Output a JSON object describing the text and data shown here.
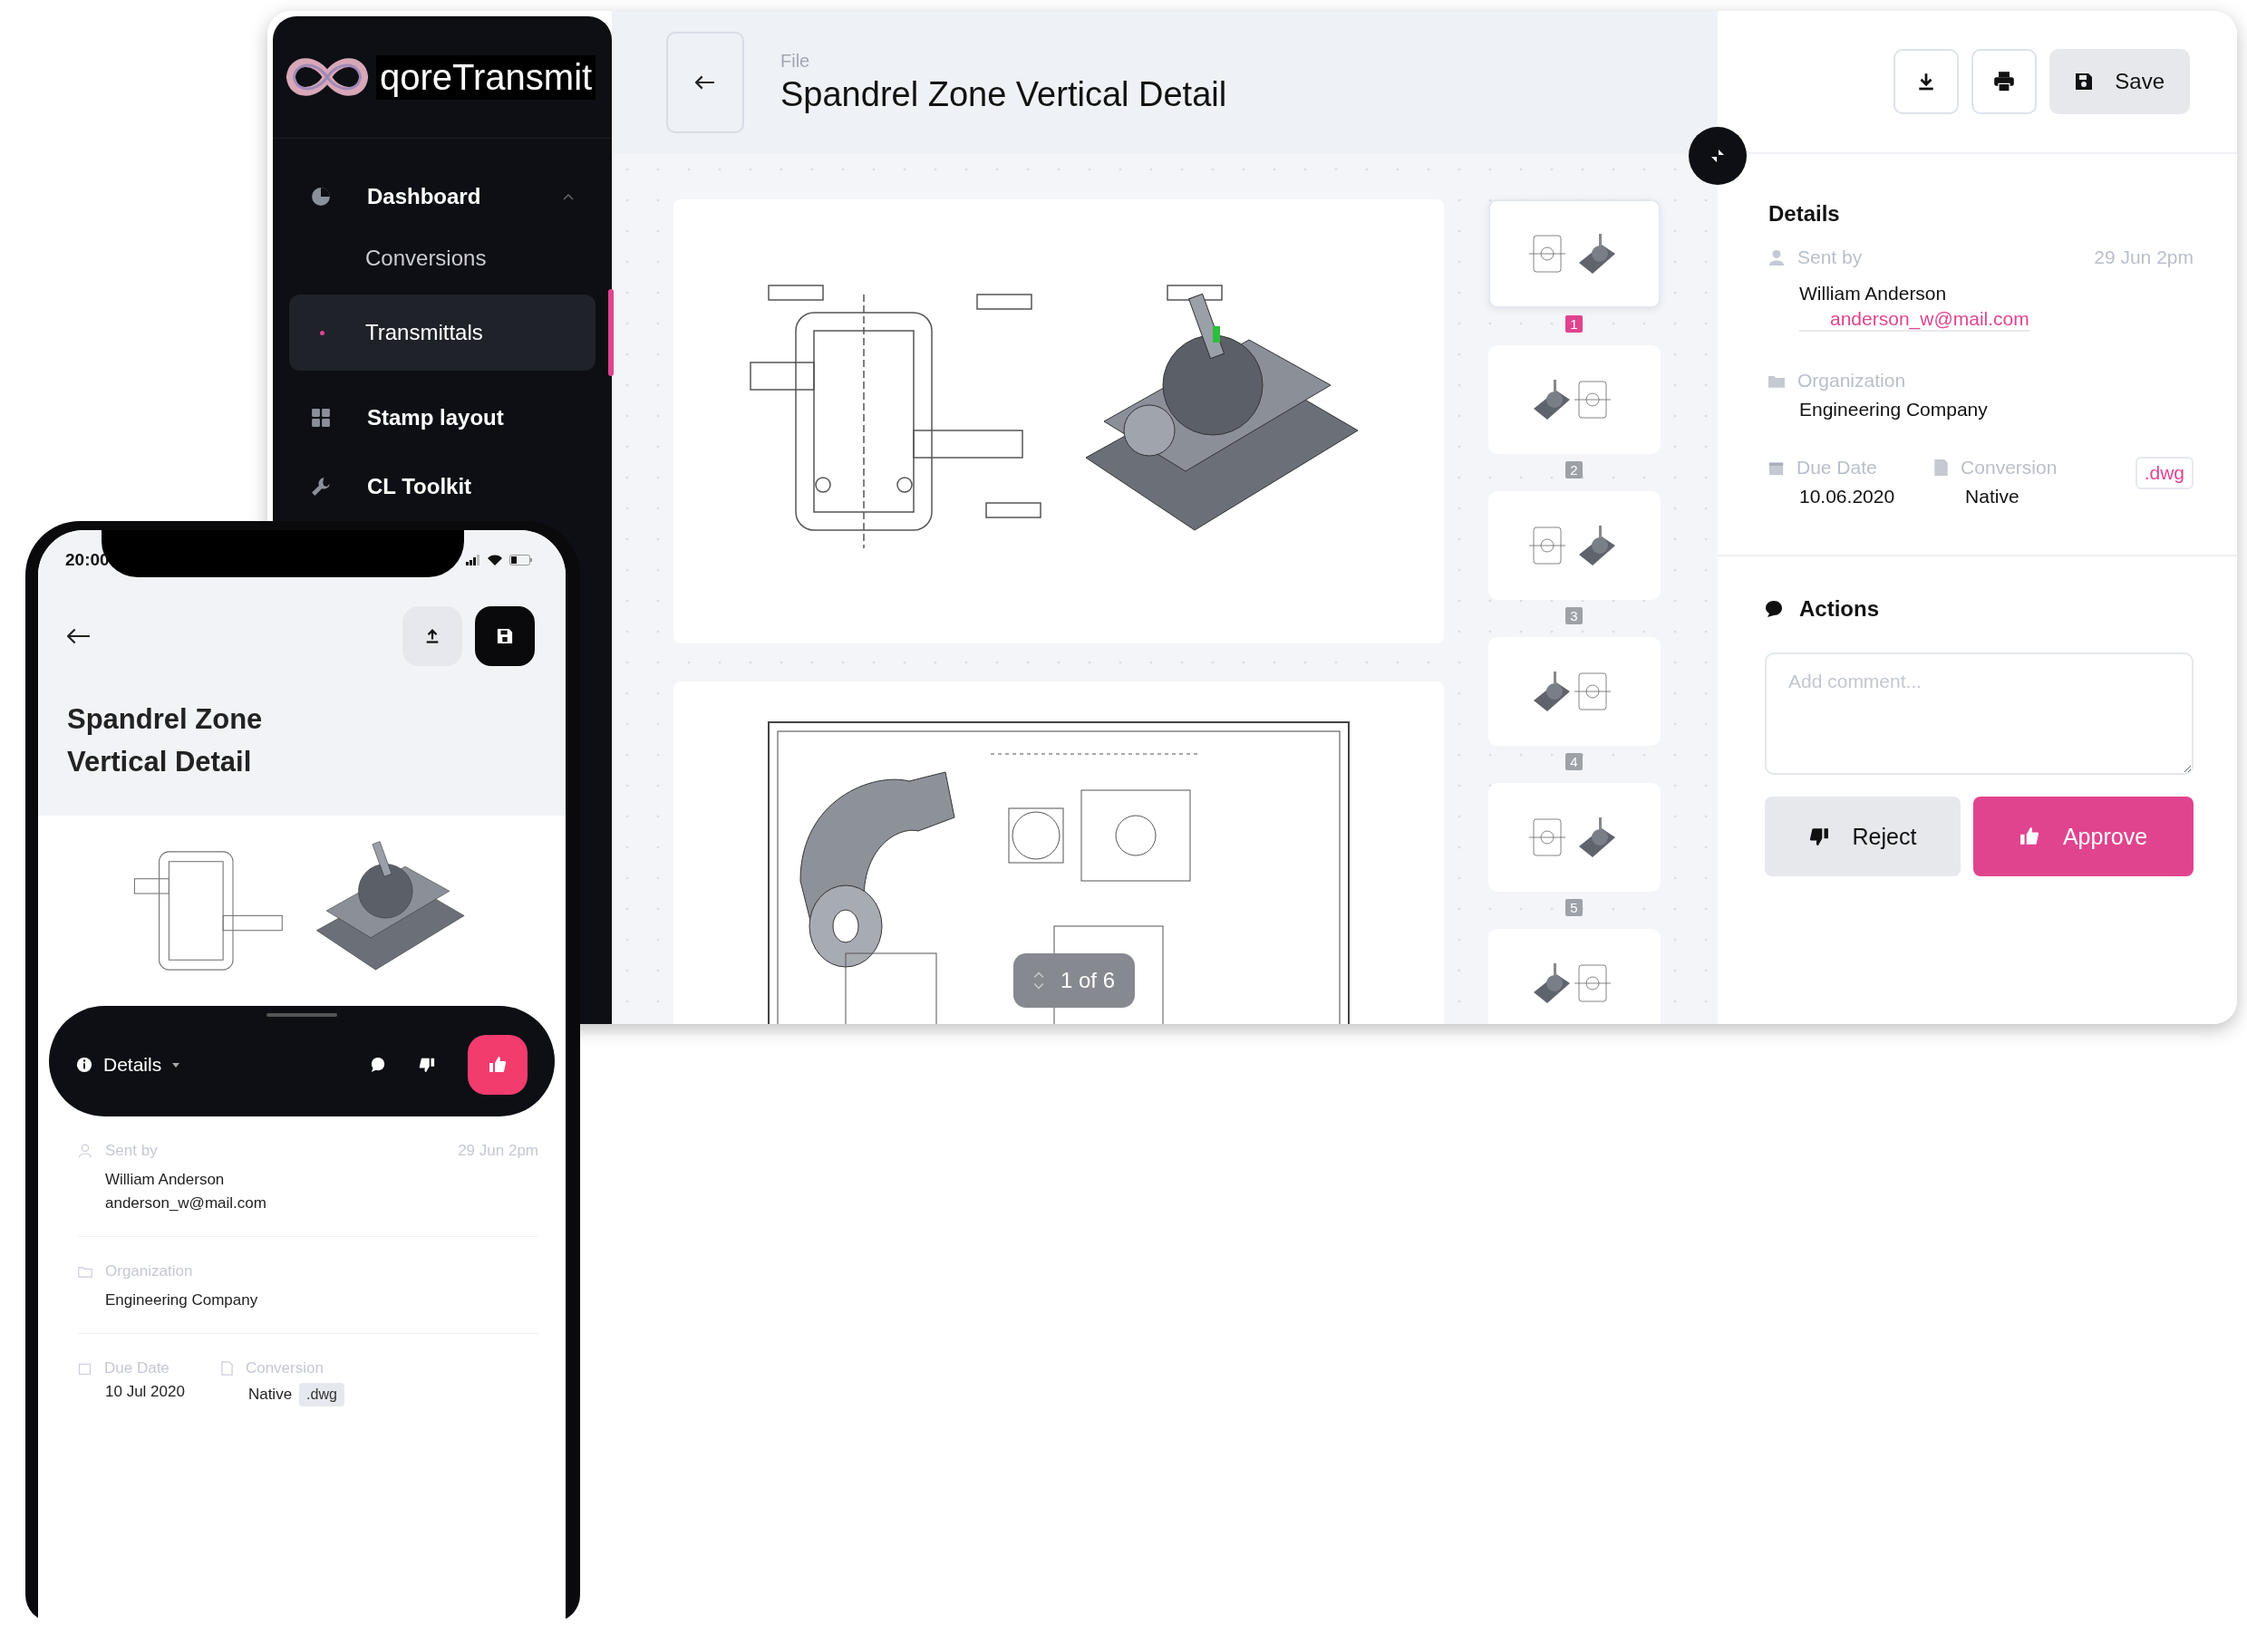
{
  "app": {
    "logo": "qoreTransmit"
  },
  "sidebar": {
    "items": [
      {
        "label": "Dashboard",
        "selected": false,
        "expanded": true,
        "children": [
          {
            "label": "Conversions",
            "selected": false
          },
          {
            "label": "Transmittals",
            "selected": true
          }
        ]
      },
      {
        "label": "Stamp layout",
        "selected": false
      },
      {
        "label": "CL Toolkit",
        "selected": false
      }
    ]
  },
  "header": {
    "overline": "File",
    "title": "Spandrel Zone Vertical Detail"
  },
  "viewer": {
    "page_indicator": "1 of 6",
    "thumbnails": [
      {
        "number": "1",
        "selected": true
      },
      {
        "number": "2",
        "selected": false
      },
      {
        "number": "3",
        "selected": false
      },
      {
        "number": "4",
        "selected": false
      },
      {
        "number": "5",
        "selected": false
      },
      {
        "selected": false
      }
    ]
  },
  "toolbar": {
    "save": "Save"
  },
  "details": {
    "heading": "Details",
    "sent_by_label": "Sent by",
    "sent_time": "29 Jun 2pm",
    "sender_name": "William Anderson",
    "sender_email": "anderson_w@mail.com",
    "organization_label": "Organization",
    "organization": "Engineering Company",
    "due_date_label": "Due Date",
    "due_date": "10.06.2020",
    "conversion_label": "Conversion",
    "conversion": "Native",
    "file_type": ".dwg"
  },
  "actions": {
    "heading": "Actions",
    "comment_placeholder": "Add comment...",
    "buttons": [
      {
        "label": "Reject",
        "kind": "secondary"
      },
      {
        "label": "Approve",
        "kind": "primary"
      }
    ]
  },
  "phone": {
    "time": "20:00",
    "title": "Spandrel Zone Vertical Detail",
    "sheet_tab": "Details",
    "details": {
      "sent_by_label": "Sent by",
      "sent_time": "29 Jun 2pm",
      "sender_name": "William Anderson",
      "sender_email": "anderson_w@mail.com",
      "organization_label": "Organization",
      "organization": "Engineering Company",
      "due_date_label": "Due Date",
      "due_date": "10 Jul 2020",
      "conversion_label": "Conversion",
      "conversion": "Native",
      "file_type": ".dwg"
    }
  }
}
